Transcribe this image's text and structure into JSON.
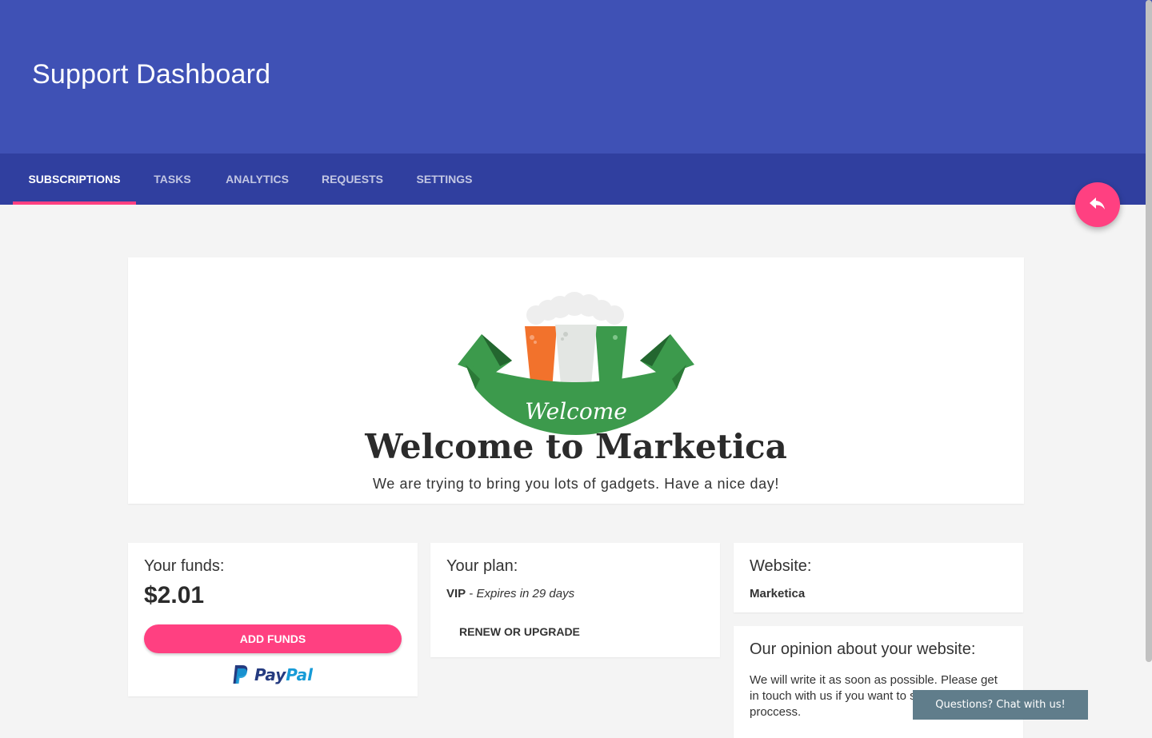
{
  "header": {
    "title": "Support Dashboard"
  },
  "tabs": [
    {
      "label": "SUBSCRIPTIONS",
      "active": true
    },
    {
      "label": "TASKS",
      "active": false
    },
    {
      "label": "ANALYTICS",
      "active": false
    },
    {
      "label": "REQUESTS",
      "active": false
    },
    {
      "label": "SETTINGS",
      "active": false
    }
  ],
  "fab": {
    "icon": "reply-icon"
  },
  "welcome": {
    "logo_text": "Welcome",
    "title": "Welcome to Marketica",
    "subtitle": "We are trying to bring you lots of gadgets. Have a nice day!"
  },
  "funds": {
    "label": "Your funds:",
    "amount": "$2.01",
    "button_label": "ADD FUNDS",
    "payment_logo": {
      "pay": "Pay",
      "pal": "Pal"
    }
  },
  "plan": {
    "label": "Your plan:",
    "name": "VIP",
    "separator": " - ",
    "expiry": "Expires in 29 days",
    "button_label": "RENEW OR UPGRADE"
  },
  "website": {
    "label": "Website:",
    "name": "Marketica"
  },
  "opinion": {
    "label": "Our opinion about your website:",
    "text": "We will write it as soon as possible. Please get in touch with us if you want to speed up the proccess."
  },
  "chat": {
    "label": "Questions? Chat with us!"
  },
  "colors": {
    "primary": "#3f51b5",
    "primary_dark": "#303f9f",
    "accent": "#ff4081",
    "chat": "#607d8b",
    "logo_green": "#3c9a4c",
    "logo_orange": "#f2722c"
  }
}
